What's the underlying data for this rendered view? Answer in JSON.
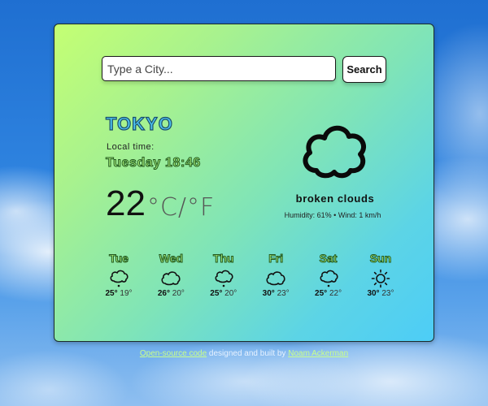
{
  "search": {
    "placeholder": "Type a City...",
    "value": "",
    "button_label": "Search"
  },
  "current": {
    "city": "TOKYO",
    "local_time_label": "Local time:",
    "local_time": "Tuesday 18:46",
    "temperature": "22",
    "units": "°C/°F",
    "icon": "cloud-icon",
    "condition": "broken clouds",
    "details": "Humidity: 61% • Wind: 1 km/h"
  },
  "forecast": [
    {
      "day": "Tue",
      "icon": "rain-cloud-icon",
      "high": "25°",
      "low": "19°"
    },
    {
      "day": "Wed",
      "icon": "cloud-icon",
      "high": "26°",
      "low": "20°"
    },
    {
      "day": "Thu",
      "icon": "rain-cloud-icon",
      "high": "25°",
      "low": "20°"
    },
    {
      "day": "Fri",
      "icon": "cloud-icon",
      "high": "30°",
      "low": "23°"
    },
    {
      "day": "Sat",
      "icon": "rain-cloud-icon",
      "high": "25°",
      "low": "22°"
    },
    {
      "day": "Sun",
      "icon": "sun-icon",
      "high": "30°",
      "low": "23°"
    }
  ],
  "footer": {
    "link_source": "Open-source code",
    "middle_text": " designed and built by ",
    "link_author": "Noam Ackerman"
  },
  "colors": {
    "card_gradient_start": "#c4ff73",
    "card_gradient_end": "#4dcdf7",
    "city_fill": "#4dc0ee",
    "accent_green": "#a8f07a"
  }
}
